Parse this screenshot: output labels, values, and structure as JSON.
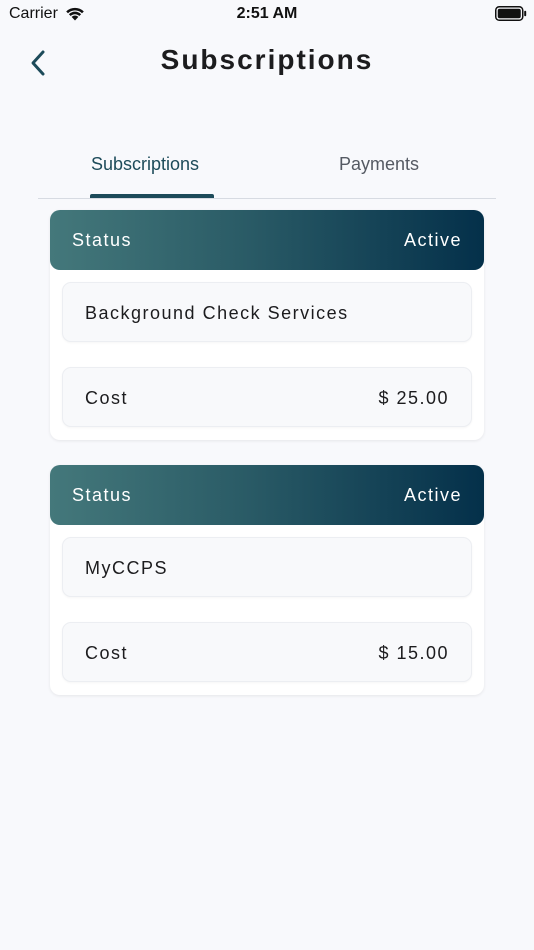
{
  "status_bar": {
    "carrier": "Carrier",
    "time": "2:51 AM"
  },
  "nav": {
    "title": "Subscriptions",
    "back_icon": "chevron-left-icon"
  },
  "tabs": [
    {
      "label": "Subscriptions",
      "selected": true
    },
    {
      "label": "Payments",
      "selected": false
    }
  ],
  "colors": {
    "accent": "#1d4b5a",
    "header_gradient_start": "#44787b",
    "header_gradient_end": "#04304a",
    "background": "#f8f9fc"
  },
  "subscriptions": [
    {
      "status_label": "Status",
      "status_value": "Active",
      "name": "Background Check Services",
      "cost_label": "Cost",
      "cost_value": "$ 25.00"
    },
    {
      "status_label": "Status",
      "status_value": "Active",
      "name": "MyCCPS",
      "cost_label": "Cost",
      "cost_value": "$ 15.00"
    }
  ]
}
